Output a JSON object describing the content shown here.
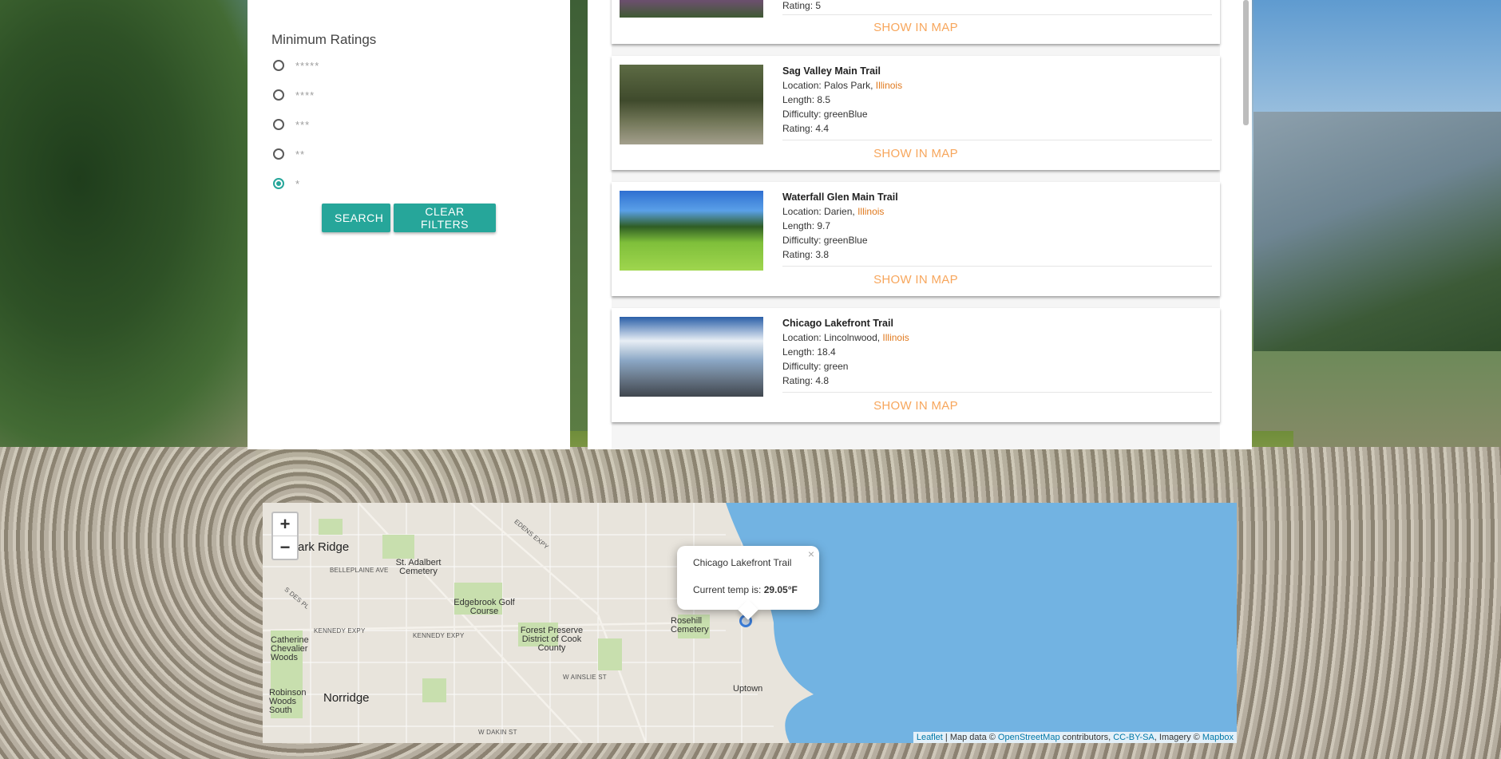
{
  "filters": {
    "title": "Minimum Ratings",
    "ratings": [
      {
        "label": "*****",
        "checked": false
      },
      {
        "label": "****",
        "checked": false
      },
      {
        "label": "***",
        "checked": false
      },
      {
        "label": "**",
        "checked": false
      },
      {
        "label": "*",
        "checked": true
      }
    ],
    "search_label": "SEARCH",
    "clear_label": "CLEAR FILTERS"
  },
  "trails": {
    "partial_top": {
      "rating": "Rating: 5",
      "show_map": "SHOW IN MAP"
    },
    "items": [
      {
        "name": "Sag Valley Main Trail",
        "location_prefix": "Location: Palos Park, ",
        "location_state": "Illinois",
        "length": "Length: 8.5",
        "difficulty": "Difficulty: greenBlue",
        "rating": "Rating: 4.4",
        "show_map": "SHOW IN MAP"
      },
      {
        "name": "Waterfall Glen Main Trail",
        "location_prefix": "Location: Darien, ",
        "location_state": "Illinois",
        "length": "Length: 9.7",
        "difficulty": "Difficulty: greenBlue",
        "rating": "Rating: 3.8",
        "show_map": "SHOW IN MAP"
      },
      {
        "name": "Chicago Lakefront Trail",
        "location_prefix": "Location: Lincolnwood, ",
        "location_state": "Illinois",
        "length": "Length: 18.4",
        "difficulty": "Difficulty: green",
        "rating": "Rating: 4.8",
        "show_map": "SHOW IN MAP"
      }
    ]
  },
  "map": {
    "zoom_in": "+",
    "zoom_out": "−",
    "popup": {
      "title": "Chicago Lakefront Trail",
      "temp_prefix": "Current temp is: ",
      "temp_value": "29.05°F",
      "close": "×"
    },
    "labels": {
      "park_ridge": "Park Ridge",
      "norridge": "Norridge",
      "st_adalbert": "St. Adalbert Cemetery",
      "edgebrook": "Edgebrook Golf Course",
      "forest_preserve": "Forest Preserve District of Cook County",
      "rosehill": "Rosehill Cemetery",
      "uptown": "Uptown",
      "catherine": "Catherine Chevalier Woods",
      "robinson": "Robinson Woods South"
    },
    "streets": {
      "belleplaine": "BELLEPLAINE AVE",
      "kennedy_1": "KENNEDY EXPY",
      "kennedy_2": "KENNEDY EXPY",
      "ainslie": "W AINSLIE ST",
      "dakin": "W DAKIN ST",
      "edens": "EDENS EXPY",
      "des_plaines": "S DES PL"
    },
    "attribution": {
      "leaflet": "Leaflet",
      "text1": " | Map data © ",
      "osm": "OpenStreetMap",
      "text2": " contributors, ",
      "cc": "CC-BY-SA",
      "text3": ", Imagery © ",
      "mapbox": "Mapbox"
    },
    "colors": {
      "water": "#72b3e2",
      "land": "#e8e4dc",
      "park": "#c8dfae"
    }
  }
}
